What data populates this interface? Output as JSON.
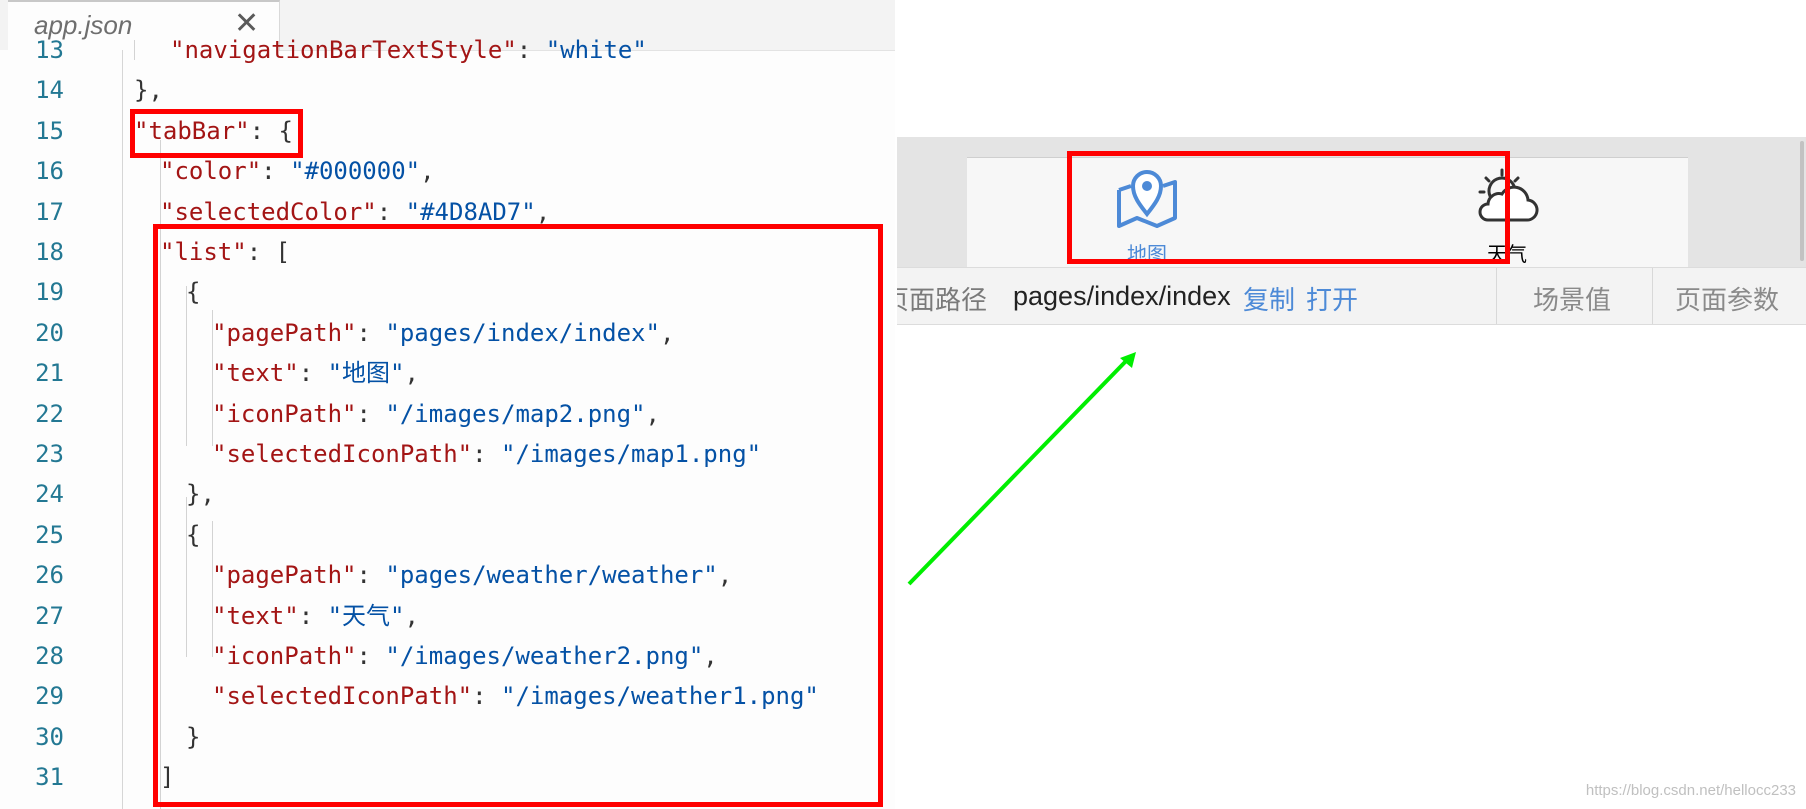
{
  "editor": {
    "tab_title": "app.json",
    "close_glyph": "✕",
    "lines": [
      {
        "n": "13",
        "tokens": [
          {
            "t": "\"navigationBarTextStyle\"",
            "c": "k"
          },
          {
            "t": ": ",
            "c": "p"
          },
          {
            "t": "\"white\"",
            "c": "s"
          }
        ]
      },
      {
        "n": "14",
        "tokens": [
          {
            "t": "},",
            "c": "p"
          }
        ]
      },
      {
        "n": "15",
        "tokens": [
          {
            "t": "\"tabBar\"",
            "c": "k"
          },
          {
            "t": ": {",
            "c": "p"
          }
        ]
      },
      {
        "n": "16",
        "tokens": [
          {
            "t": "\"color\"",
            "c": "k"
          },
          {
            "t": ": ",
            "c": "p"
          },
          {
            "t": "\"#000000\"",
            "c": "s"
          },
          {
            "t": ",",
            "c": "p"
          }
        ]
      },
      {
        "n": "17",
        "tokens": [
          {
            "t": "\"selectedColor\"",
            "c": "k"
          },
          {
            "t": ": ",
            "c": "p"
          },
          {
            "t": "\"#4D8AD7\"",
            "c": "s"
          },
          {
            "t": ",",
            "c": "p"
          }
        ]
      },
      {
        "n": "18",
        "tokens": [
          {
            "t": "\"list\"",
            "c": "k"
          },
          {
            "t": ": [",
            "c": "p"
          }
        ]
      },
      {
        "n": "19",
        "tokens": [
          {
            "t": "{",
            "c": "p"
          }
        ]
      },
      {
        "n": "20",
        "tokens": [
          {
            "t": "\"pagePath\"",
            "c": "k"
          },
          {
            "t": ": ",
            "c": "p"
          },
          {
            "t": "\"pages/index/index\"",
            "c": "s"
          },
          {
            "t": ",",
            "c": "p"
          }
        ]
      },
      {
        "n": "21",
        "tokens": [
          {
            "t": "\"text\"",
            "c": "k"
          },
          {
            "t": ": ",
            "c": "p"
          },
          {
            "t": "\"地图\"",
            "c": "s"
          },
          {
            "t": ",",
            "c": "p"
          }
        ]
      },
      {
        "n": "22",
        "tokens": [
          {
            "t": "\"iconPath\"",
            "c": "k"
          },
          {
            "t": ": ",
            "c": "p"
          },
          {
            "t": "\"/images/map2.png\"",
            "c": "s"
          },
          {
            "t": ",",
            "c": "p"
          }
        ]
      },
      {
        "n": "23",
        "tokens": [
          {
            "t": "\"selectedIconPath\"",
            "c": "k"
          },
          {
            "t": ": ",
            "c": "p"
          },
          {
            "t": "\"/images/map1.png\"",
            "c": "s"
          }
        ]
      },
      {
        "n": "24",
        "tokens": [
          {
            "t": "},",
            "c": "p"
          }
        ]
      },
      {
        "n": "25",
        "tokens": [
          {
            "t": "{",
            "c": "p"
          }
        ]
      },
      {
        "n": "26",
        "tokens": [
          {
            "t": "\"pagePath\"",
            "c": "k"
          },
          {
            "t": ": ",
            "c": "p"
          },
          {
            "t": "\"pages/weather/weather\"",
            "c": "s"
          },
          {
            "t": ",",
            "c": "p"
          }
        ]
      },
      {
        "n": "27",
        "tokens": [
          {
            "t": "\"text\"",
            "c": "k"
          },
          {
            "t": ": ",
            "c": "p"
          },
          {
            "t": "\"天气\"",
            "c": "s"
          },
          {
            "t": ",",
            "c": "p"
          }
        ]
      },
      {
        "n": "28",
        "tokens": [
          {
            "t": "\"iconPath\"",
            "c": "k"
          },
          {
            "t": ": ",
            "c": "p"
          },
          {
            "t": "\"/images/weather2.png\"",
            "c": "s"
          },
          {
            "t": ",",
            "c": "p"
          }
        ]
      },
      {
        "n": "29",
        "tokens": [
          {
            "t": "\"selectedIconPath\"",
            "c": "k"
          },
          {
            "t": ": ",
            "c": "p"
          },
          {
            "t": "\"/images/weather1.png\"",
            "c": "s"
          }
        ]
      },
      {
        "n": "30",
        "tokens": [
          {
            "t": "}",
            "c": "p"
          }
        ]
      },
      {
        "n": "31",
        "tokens": [
          {
            "t": "]",
            "c": "p"
          }
        ]
      }
    ]
  },
  "preview": {
    "tabs": [
      {
        "label": "地图",
        "icon": "map-pin-icon",
        "color": "#4D8AD7",
        "selected": true
      },
      {
        "label": "天气",
        "icon": "weather-cloud-icon",
        "color": "#000000",
        "selected": false
      }
    ],
    "status": {
      "page_path_label": "页面路径",
      "page_path_value": "pages/index/index",
      "copy_label": "复制",
      "open_label": "打开",
      "scene_label": "场景值",
      "params_label": "页面参数"
    }
  },
  "colors": {
    "highlight": "#ff0000",
    "arrow": "#00ee00",
    "selected": "#4D8AD7"
  },
  "watermark": "https://blog.csdn.net/hellocc233"
}
